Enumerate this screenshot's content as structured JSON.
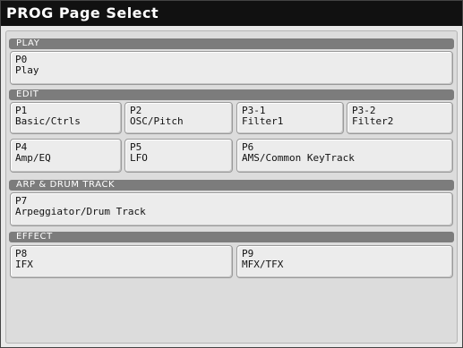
{
  "title": "PROG Page Select",
  "sections": {
    "play": "PLAY",
    "edit": "EDIT",
    "arp": "ARP & DRUM TRACK",
    "effect": "EFFECT"
  },
  "pages": {
    "p0": {
      "num": "P0",
      "label": "Play"
    },
    "p1": {
      "num": "P1",
      "label": "Basic/Ctrls"
    },
    "p2": {
      "num": "P2",
      "label": "OSC/Pitch"
    },
    "p3_1": {
      "num": "P3-1",
      "label": "Filter1"
    },
    "p3_2": {
      "num": "P3-2",
      "label": "Filter2"
    },
    "p4": {
      "num": "P4",
      "label": "Amp/EQ"
    },
    "p5": {
      "num": "P5",
      "label": "LFO"
    },
    "p6": {
      "num": "P6",
      "label": "AMS/Common KeyTrack"
    },
    "p7": {
      "num": "P7",
      "label": "Arpeggiator/Drum Track"
    },
    "p8": {
      "num": "P8",
      "label": "IFX"
    },
    "p9": {
      "num": "P9",
      "label": "MFX/TFX"
    }
  }
}
